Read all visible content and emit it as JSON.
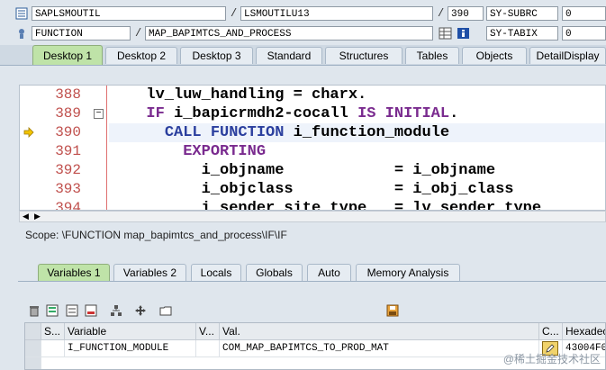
{
  "header": {
    "program": "SAPLSMOUTIL",
    "include": "LSMOUTILU13",
    "line": "390",
    "sy_subrc_label": "SY-SUBRC",
    "sy_subrc_value": "0",
    "event_type": "FUNCTION",
    "event_name": "MAP_BAPIMTCS_AND_PROCESS",
    "sy_tabix_label": "SY-TABIX",
    "sy_tabix_value": "0",
    "slash": "/"
  },
  "desktop_tabs": [
    {
      "label": "Desktop 1",
      "active": true
    },
    {
      "label": "Desktop 2",
      "active": false
    },
    {
      "label": "Desktop 3",
      "active": false
    },
    {
      "label": "Standard",
      "active": false
    },
    {
      "label": "Structures",
      "active": false
    },
    {
      "label": "Tables",
      "active": false
    },
    {
      "label": "Objects",
      "active": false
    },
    {
      "label": "DetailDisplay",
      "active": false
    }
  ],
  "code": {
    "lines": [
      {
        "num": "388",
        "text": "  lv_luw_handling = charx."
      },
      {
        "num": "389",
        "text": "  IF i_bapicrmdh2-cocall IS INITIAL."
      },
      {
        "num": "390",
        "text": "    CALL FUNCTION i_function_module"
      },
      {
        "num": "391",
        "text": "      EXPORTING"
      },
      {
        "num": "392",
        "text": "        i_objname            = i_objname"
      },
      {
        "num": "393",
        "text": "        i_objclass           = i_obj_class"
      },
      {
        "num": "394",
        "text": "        i_sender_site_type   = lv_sender_type"
      }
    ],
    "current_line": "390",
    "collapse_marker": "−"
  },
  "scope": "Scope: \\FUNCTION map_bapimtcs_and_process\\IF\\IF",
  "var_tabs": [
    {
      "label": "Variables 1",
      "active": true
    },
    {
      "label": "Variables 2",
      "active": false
    },
    {
      "label": "Locals",
      "active": false
    },
    {
      "label": "Globals",
      "active": false
    },
    {
      "label": "Auto",
      "active": false
    },
    {
      "label": "Memory Analysis",
      "active": false
    }
  ],
  "grid": {
    "columns": [
      "S...",
      "Variable",
      "V...",
      "Val.",
      "C...",
      "Hexadec"
    ],
    "rows": [
      {
        "s": "",
        "variable": "I_FUNCTION_MODULE",
        "v": "",
        "value": "COM_MAP_BAPIMTCS_TO_PROD_MAT",
        "c": "",
        "hex": "43004F0"
      }
    ]
  },
  "watermark": "@稀土掘金技术社区",
  "colors": {
    "active_tab": "#bfe3a8",
    "line_numbers": "#c0504d",
    "keyword": "#7a2b8f",
    "call_keyword": "#2b3f9e"
  }
}
